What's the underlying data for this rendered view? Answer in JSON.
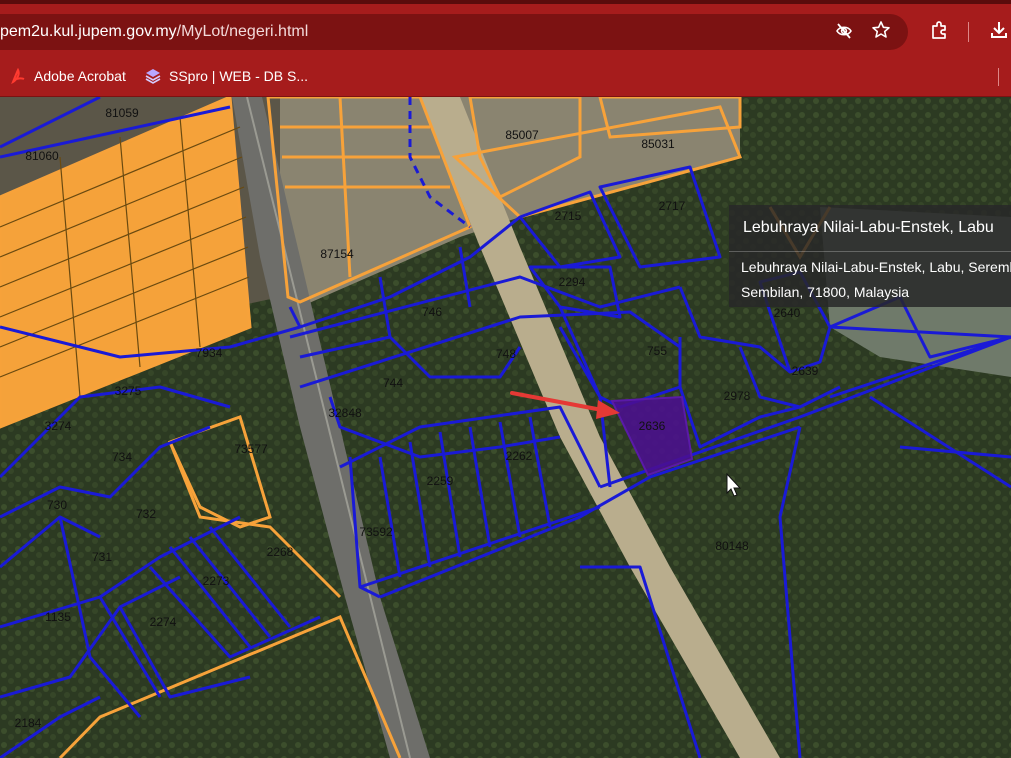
{
  "browser": {
    "url_host": "pem2u.kul.jupem.gov.my",
    "url_path": "/MyLot/negeri.html",
    "icons": [
      "eye-off-icon",
      "star-icon",
      "extension-icon",
      "download-icon"
    ],
    "bookmarks": [
      {
        "label": "Adobe Acrobat",
        "icon": "acrobat-icon"
      },
      {
        "label": "SSpro | WEB - DB S...",
        "icon": "sspro-icon"
      }
    ]
  },
  "map": {
    "lot_labels": [
      {
        "id": "81059"
      },
      {
        "id": "81060"
      },
      {
        "id": "85007"
      },
      {
        "id": "85031"
      },
      {
        "id": "2715"
      },
      {
        "id": "2717"
      },
      {
        "id": "87154"
      },
      {
        "id": "2294"
      },
      {
        "id": "746"
      },
      {
        "id": "748"
      },
      {
        "id": "755"
      },
      {
        "id": "2640"
      },
      {
        "id": "7934"
      },
      {
        "id": "3275"
      },
      {
        "id": "744"
      },
      {
        "id": "2639"
      },
      {
        "id": "2978"
      },
      {
        "id": "32848"
      },
      {
        "id": "2636"
      },
      {
        "id": "3274"
      },
      {
        "id": "734"
      },
      {
        "id": "73577"
      },
      {
        "id": "2262"
      },
      {
        "id": "2259"
      },
      {
        "id": "730"
      },
      {
        "id": "732"
      },
      {
        "id": "73592"
      },
      {
        "id": "80148"
      },
      {
        "id": "731"
      },
      {
        "id": "2268"
      },
      {
        "id": "2273"
      },
      {
        "id": "1135"
      },
      {
        "id": "2274"
      },
      {
        "id": "2184"
      }
    ],
    "highlighted_lot": "2636",
    "colors": {
      "blue_boundary": "#1a1ad6",
      "orange_boundary": "#f7a23a",
      "highlight_fill": "#4b0f8f",
      "arrow": "#e53935"
    }
  },
  "tooltip": {
    "title": "Lebuhraya Nilai-Labu-Enstek, Labu",
    "address_line1": "Lebuhraya Nilai-Labu-Enstek, Labu, Seremban, Negeri",
    "address_line2": "Sembilan, 71800, Malaysia"
  }
}
